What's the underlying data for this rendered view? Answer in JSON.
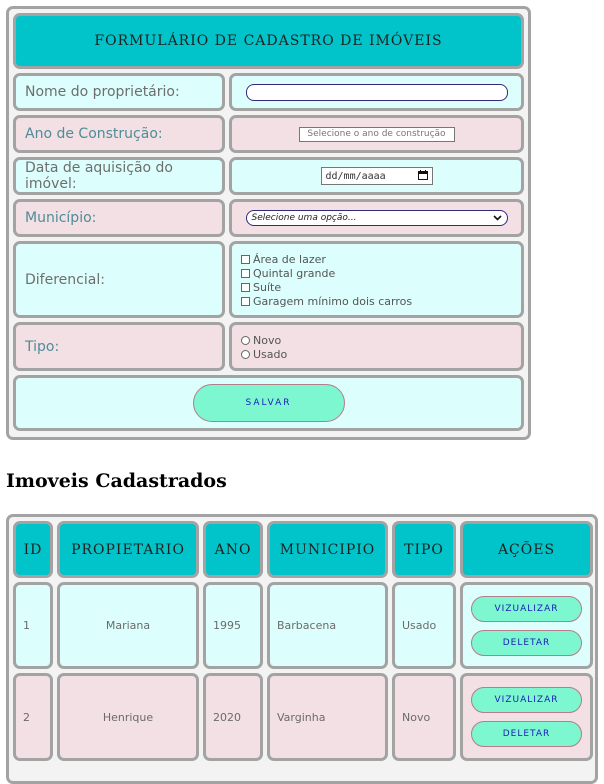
{
  "form": {
    "title": "FORMULÁRIO DE CADASTRO DE IMÓVEIS",
    "owner_label": "Nome do proprietário:",
    "owner_value": "",
    "year_label": "Ano de Construção:",
    "year_placeholder": "Selecione o ano de construção",
    "date_label": "Data de aquisição do imóvel:",
    "date_placeholder": "dd/mm/aaaa",
    "city_label": "Município:",
    "city_selected": "Selecione uma opção...",
    "extras_label": "Diferencial:",
    "extras": [
      "Área de lazer",
      "Quintal grande",
      "Suíte",
      "Garagem mínimo dois carros"
    ],
    "type_label": "Tipo:",
    "types": [
      "Novo",
      "Usado"
    ],
    "save_label": "SALVAR"
  },
  "list": {
    "heading": "Imoveis Cadastrados",
    "columns": [
      "ID",
      "PROPIETARIO",
      "ANO",
      "MUNICIPIO",
      "TIPO",
      "AÇÕES"
    ],
    "rows": [
      {
        "id": "1",
        "owner": "Mariana",
        "year": "1995",
        "city": "Barbacena",
        "type": "Usado"
      },
      {
        "id": "2",
        "owner": "Henrique",
        "year": "2020",
        "city": "Varginha",
        "type": "Novo"
      }
    ],
    "view_label": "VIZUALIZAR",
    "delete_label": "DELETAR"
  },
  "colors": {
    "header_bg": "#00c4c9",
    "row_cyan": "#dcfffd",
    "row_pink": "#f2e0e4",
    "button_bg": "#7cf7cf",
    "button_text": "#1c1cb8",
    "border": "#a3a3a3"
  },
  "icons": {
    "date_picker": "calendar-icon",
    "city_select": "chevron-down-icon"
  }
}
